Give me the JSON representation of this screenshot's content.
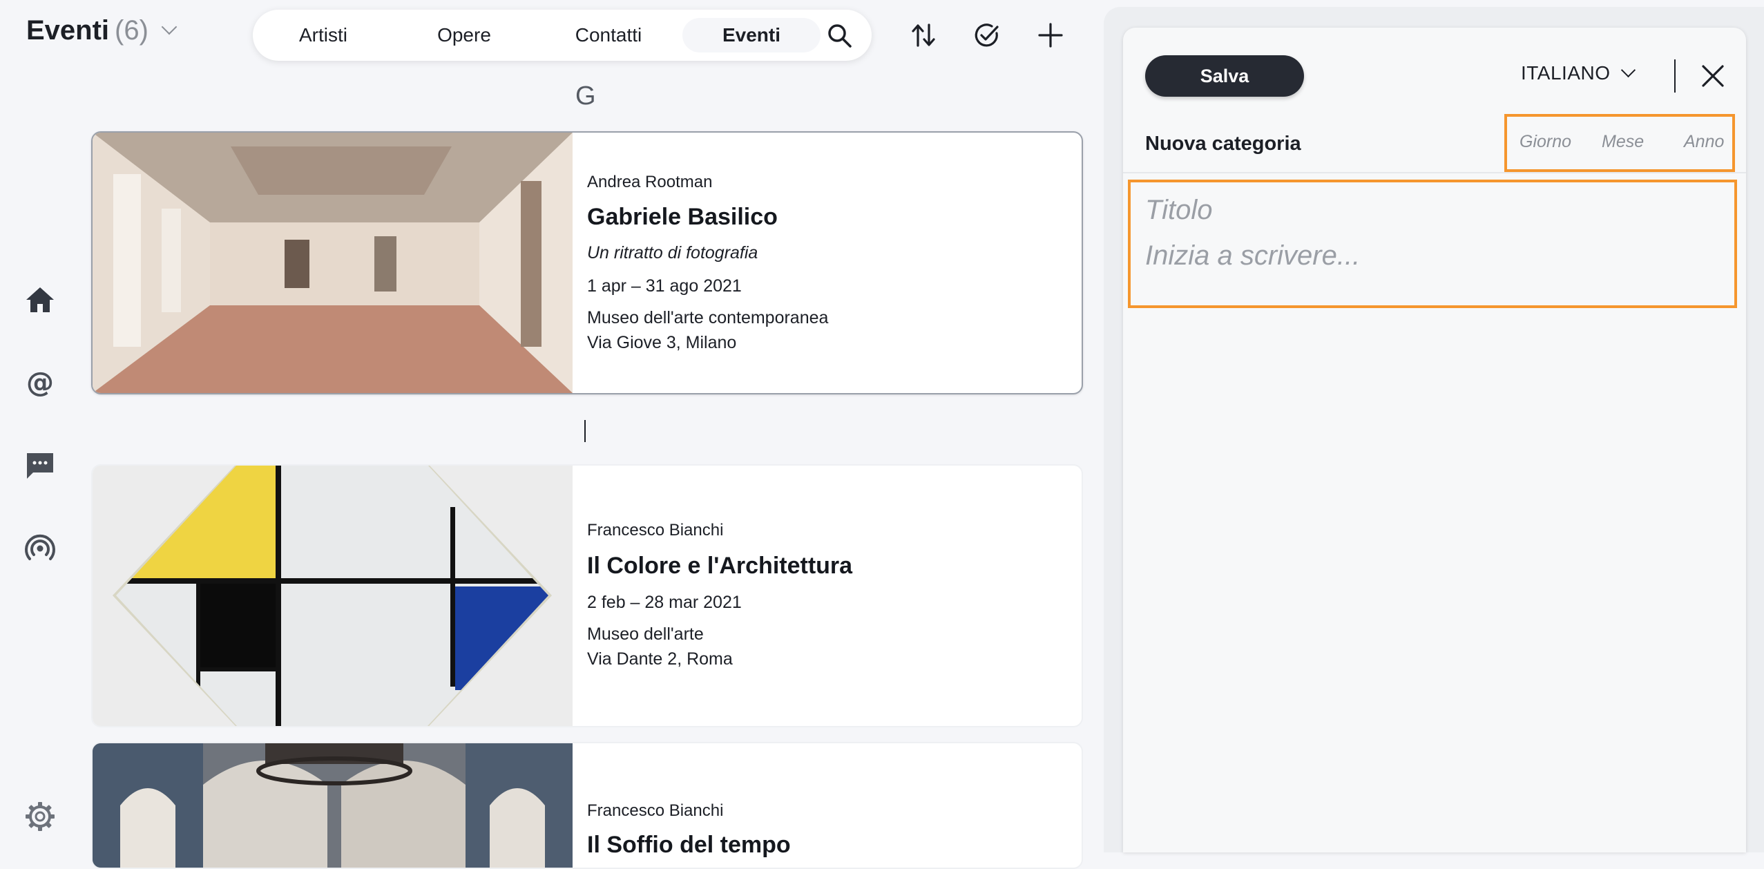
{
  "header": {
    "title": "Eventi",
    "count": "(6)",
    "tabs": [
      {
        "label": "Artisti",
        "active": false
      },
      {
        "label": "Opere",
        "active": false
      },
      {
        "label": "Contatti",
        "active": false
      },
      {
        "label": "Eventi",
        "active": true
      }
    ],
    "icons": [
      "search-icon",
      "sort-icon",
      "check-circle-icon",
      "add-icon"
    ]
  },
  "sidebar": {
    "icons": [
      "home-icon",
      "at-icon",
      "chat-icon",
      "broadcast-icon",
      "settings-icon"
    ]
  },
  "list": {
    "section_letter": "G",
    "events": [
      {
        "artist": "Andrea Rootman",
        "title": "Gabriele Basilico",
        "subtitle": "Un ritratto di fotografia",
        "dates": "1 apr – 31 ago 2021",
        "venue": "Museo dell'arte contemporanea",
        "address": "Via Giove 3, Milano",
        "selected": true
      },
      {
        "artist": "Francesco Bianchi",
        "title": "Il Colore e l'Architettura",
        "dates": "2 feb – 28 mar 2021",
        "venue": "Museo dell'arte",
        "address": "Via Dante 2, Roma",
        "selected": false
      },
      {
        "artist": "Francesco Bianchi",
        "title": "Il Soffio del tempo",
        "selected": false
      }
    ]
  },
  "editor": {
    "save_label": "Salva",
    "language": "ITALIANO",
    "category": "Nuova categoria",
    "date_placeholders": {
      "day": "Giorno",
      "month": "Mese",
      "year": "Anno"
    },
    "title_placeholder": "Titolo",
    "body_placeholder": "Inizia a scrivere...",
    "highlight_color": "#f5962e"
  },
  "colors": {
    "background": "#f5f6f9",
    "save_button": "#262a33",
    "accent": "#f5962e"
  }
}
